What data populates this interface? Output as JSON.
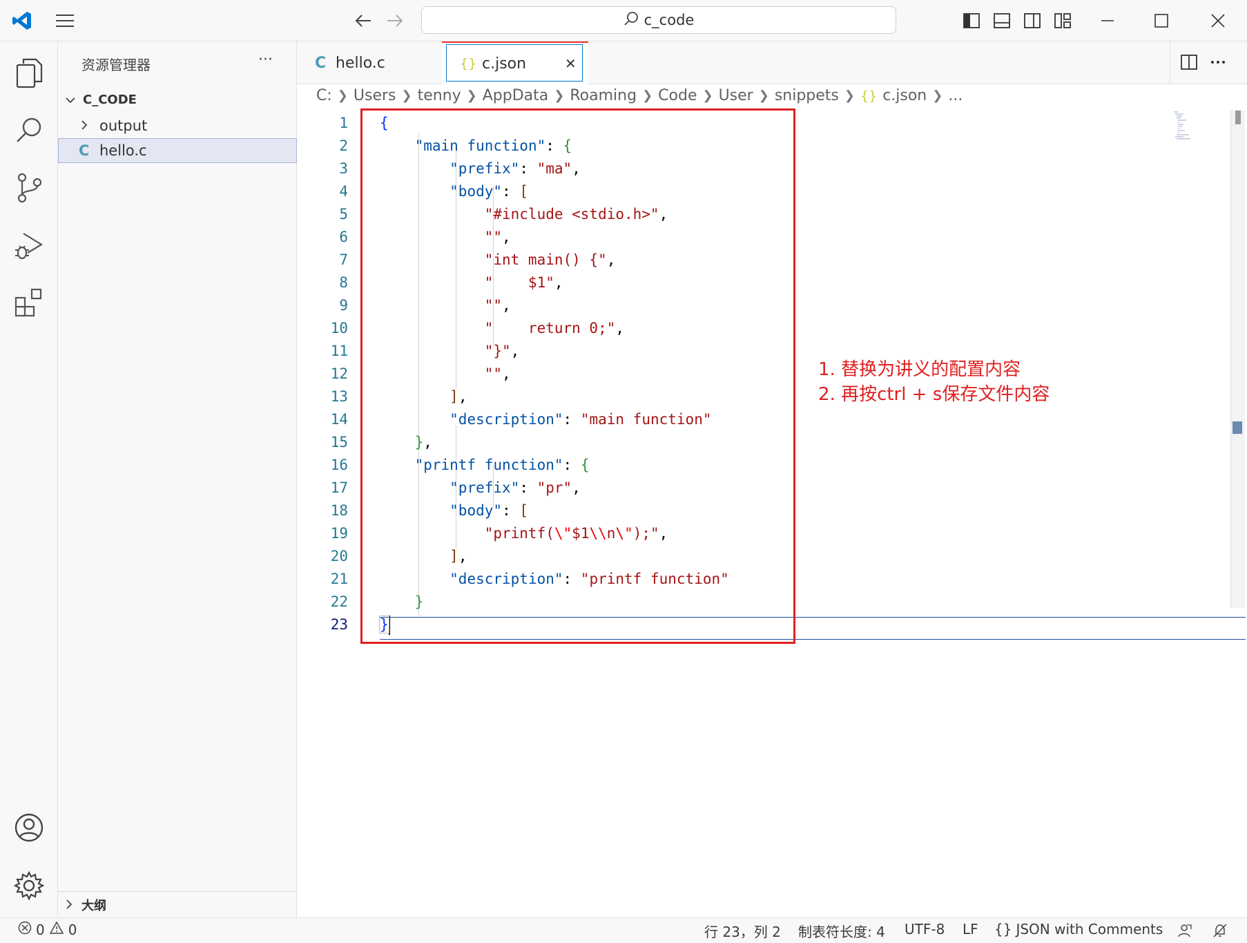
{
  "titlebar": {
    "search_text": "c_code",
    "icons": [
      "vscode-logo-icon",
      "menu-icon",
      "back-arrow-icon",
      "forward-arrow-icon",
      "search-icon",
      "toggle-primary-sidebar-icon",
      "toggle-panel-icon",
      "toggle-secondary-sidebar-icon",
      "customize-layout-icon",
      "minimize-icon",
      "maximize-icon",
      "close-icon"
    ]
  },
  "activitybar": {
    "items": [
      "explorer-icon",
      "search-icon",
      "source-control-icon",
      "run-debug-icon",
      "extensions-icon"
    ],
    "bottom": [
      "accounts-icon",
      "settings-gear-icon"
    ]
  },
  "sidebar": {
    "title": "资源管理器",
    "more": "···",
    "workspace": "C_CODE",
    "items": [
      {
        "label": "output",
        "kind": "folder"
      },
      {
        "label": "hello.c",
        "kind": "c-file",
        "icon_text": "C"
      }
    ],
    "outline_label": "大纲"
  },
  "tabs": [
    {
      "label": "hello.c",
      "icon_text": "C",
      "active": false
    },
    {
      "label": "c.json",
      "icon_text": "{}",
      "active": true,
      "close": "✕"
    }
  ],
  "breadcrumbs": [
    "C:",
    "Users",
    "tenny",
    "AppData",
    "Roaming",
    "Code",
    "User",
    "snippets",
    "c.json",
    "..."
  ],
  "breadcrumb_file_icon": "{}",
  "editor": {
    "line_numbers": [
      "1",
      "2",
      "3",
      "4",
      "5",
      "6",
      "7",
      "8",
      "9",
      "10",
      "11",
      "12",
      "13",
      "14",
      "15",
      "16",
      "17",
      "18",
      "19",
      "20",
      "21",
      "22",
      "23"
    ],
    "active_line": 23
  },
  "annotation": {
    "line1": "1. 替换为讲义的配置内容",
    "line2": "2. 再按ctrl + s保存文件内容"
  },
  "statusbar": {
    "errors": "0",
    "warnings": "0",
    "position": "行 23，列 2",
    "indent": "制表符长度: 4",
    "encoding": "UTF-8",
    "eol": "LF",
    "language_icon": "{}",
    "language": "JSON with Comments"
  },
  "colors": {
    "annotation_red": "#e02020",
    "accent_blue": "#0078d4",
    "c_icon_blue": "#519aba",
    "json_icon_yellow": "#cbcb41"
  }
}
